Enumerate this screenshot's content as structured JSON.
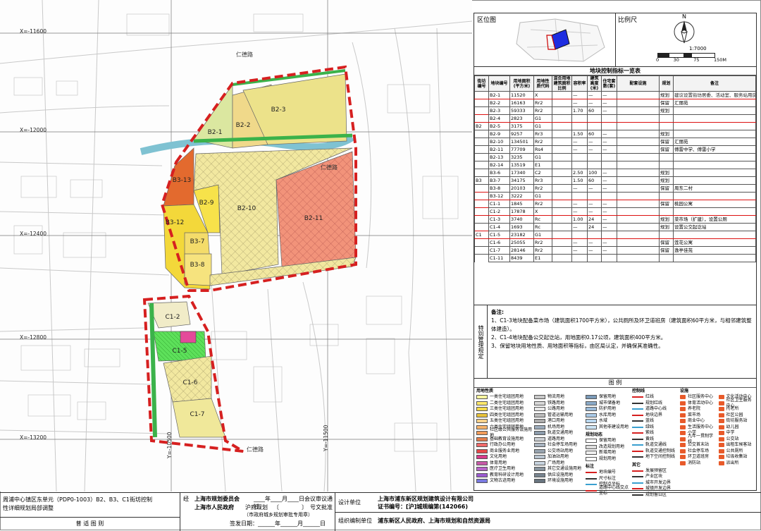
{
  "map": {
    "coords_x": [
      "X=-11600",
      "X=-12000",
      "X=-12400",
      "X=-12800",
      "X=-13200"
    ],
    "coords_y": [
      "Y=-10500",
      "Y=-11500"
    ],
    "roads": [
      "仁德路",
      "仁德路",
      "仁德路"
    ],
    "parcels": [
      "B2-3",
      "B2-2",
      "B2-1",
      "B3-13",
      "B2-9",
      "B2-10",
      "B2-11",
      "B3-12",
      "B3-7",
      "B3-8",
      "C1-2",
      "C1-5",
      "C1-6",
      "C1-7"
    ]
  },
  "panel": {
    "location_title": "区位图",
    "scale_title": "比例尺",
    "scale_ratio": "1:7000",
    "scale_ticks": [
      "0",
      "30",
      "75",
      "150M"
    ],
    "north": "N",
    "table_title": "地块控制指标一览表",
    "headers": [
      "街坊编号",
      "地块编号",
      "用地面积(平方米)",
      "用地性质代码",
      "混合用地建筑面积比例",
      "容积率",
      "建筑高度(米)",
      "住宅套数(套)",
      "配套设施",
      "规划",
      "备注"
    ],
    "rows": [
      {
        "block": "",
        "id": "B2-1",
        "area": "11520",
        "code": "X",
        "far": "—",
        "h": "—",
        "u": "—",
        "plan": "规划",
        "note": "建议设置街坊居委、活动室、服务站用房",
        "red": true
      },
      {
        "block": "",
        "id": "B2-2",
        "area": "16163",
        "code": "Rr2",
        "far": "—",
        "h": "—",
        "u": "—",
        "plan": "保留",
        "note": "汇丽苑",
        "red": false
      },
      {
        "block": "",
        "id": "B2-3",
        "area": "59333",
        "code": "Rr2",
        "far": "1.70",
        "h": "60",
        "u": "—",
        "plan": "规划",
        "note": "",
        "red": false
      },
      {
        "block": "",
        "id": "B2-4",
        "area": "2823",
        "code": "G1",
        "far": "",
        "h": "",
        "u": "",
        "plan": "",
        "note": "",
        "red": true
      },
      {
        "block": "B2",
        "id": "B2-5",
        "area": "3175",
        "code": "G1",
        "far": "",
        "h": "",
        "u": "",
        "plan": "",
        "note": "",
        "red": false
      },
      {
        "block": "",
        "id": "B2-9",
        "area": "9257",
        "code": "Rr3",
        "far": "1.50",
        "h": "60",
        "u": "—",
        "plan": "规划",
        "note": "",
        "red": false
      },
      {
        "block": "",
        "id": "B2-10",
        "area": "134501",
        "code": "Rr2",
        "far": "—",
        "h": "—",
        "u": "—",
        "plan": "保留",
        "note": "汇丽苑",
        "red": false
      },
      {
        "block": "",
        "id": "B2-11",
        "area": "77709",
        "code": "Rs4",
        "far": "—",
        "h": "—",
        "u": "—",
        "plan": "保留",
        "note": "傅雷中学、傅雷小学",
        "red": false
      },
      {
        "block": "",
        "id": "B2-13",
        "area": "3235",
        "code": "G1",
        "far": "",
        "h": "",
        "u": "",
        "plan": "",
        "note": "",
        "red": false
      },
      {
        "block": "",
        "id": "B2-14",
        "area": "13519",
        "code": "E1",
        "far": "",
        "h": "",
        "u": "",
        "plan": "",
        "note": "",
        "red": false
      },
      {
        "block": "",
        "id": "B3-6",
        "area": "17340",
        "code": "C2",
        "far": "2.50",
        "h": "100",
        "u": "—",
        "plan": "规划",
        "note": "",
        "red": false
      },
      {
        "block": "B3",
        "id": "B3-7",
        "area": "34175",
        "code": "Rr3",
        "far": "1.50",
        "h": "60",
        "u": "—",
        "plan": "规划",
        "note": "",
        "red": false
      },
      {
        "block": "",
        "id": "B3-8",
        "area": "20103",
        "code": "Rr2",
        "far": "—",
        "h": "—",
        "u": "—",
        "plan": "保留",
        "note": "周东二村",
        "red": false
      },
      {
        "block": "",
        "id": "B3-12",
        "area": "3222",
        "code": "G1",
        "far": "",
        "h": "",
        "u": "",
        "plan": "",
        "note": "",
        "red": true
      },
      {
        "block": "",
        "id": "C1-1",
        "area": "1845",
        "code": "Rr2",
        "far": "—",
        "h": "—",
        "u": "—",
        "plan": "保留",
        "note": "桃园公寓",
        "red": false
      },
      {
        "block": "",
        "id": "C1-2",
        "area": "17878",
        "code": "X",
        "far": "—",
        "h": "—",
        "u": "—",
        "plan": "",
        "note": "",
        "red": true
      },
      {
        "block": "",
        "id": "C1-3",
        "area": "3740",
        "code": "Rc",
        "far": "1.00",
        "h": "24",
        "u": "—",
        "plan": "规划",
        "note": "菜市场（扩建），设置公厕",
        "red": false
      },
      {
        "block": "",
        "id": "C1-4",
        "area": "1693",
        "code": "Rc",
        "far": "—",
        "h": "24",
        "u": "—",
        "plan": "规划",
        "note": "设置公交起讫站",
        "red": false
      },
      {
        "block": "C1",
        "id": "C1-5",
        "area": "23182",
        "code": "G1",
        "far": "",
        "h": "",
        "u": "",
        "plan": "",
        "note": "",
        "red": true
      },
      {
        "block": "",
        "id": "C1-6",
        "area": "25055",
        "code": "Rr2",
        "far": "—",
        "h": "—",
        "u": "—",
        "plan": "保留",
        "note": "莲花公寓",
        "red": false
      },
      {
        "block": "",
        "id": "C1-7",
        "area": "28146",
        "code": "Rr2",
        "far": "—",
        "h": "—",
        "u": "—",
        "plan": "保留",
        "note": "逸亭佳苑",
        "red": false
      },
      {
        "block": "",
        "id": "C1-11",
        "area": "8439",
        "code": "E1",
        "far": "",
        "h": "",
        "u": "",
        "plan": "",
        "note": "",
        "red": false
      }
    ],
    "special_title": "特别管理规定",
    "notes_title": "备注:",
    "notes": [
      "1、C1-3地块配备菜市场（建筑面积1700平方米），公共厕所及环卫道班房（建筑面积60平方米，与相邻建筑整体建造）。",
      "2、C1-4地块配备公交起讫站，用地面积0.17公顷，建筑面积400平方米。",
      "3、保留地块用地性质、用地面积等指标，由区局认定，并确保其准确性。"
    ],
    "legend_title": "图 例",
    "legend_groups": {
      "landuse": "用地性质",
      "control": "控制线",
      "facility": "设施",
      "plan_status": "规划动态",
      "mark": "标注",
      "other": "其它"
    },
    "legend_landuse": [
      {
        "c": "#fff6a0",
        "t": "一类住宅组团用地"
      },
      {
        "c": "#ffe86a",
        "t": "二类住宅组团用地"
      },
      {
        "c": "#f4d94a",
        "t": "三类住宅组团用地"
      },
      {
        "c": "#e8c23a",
        "t": "四类住宅组团用地"
      },
      {
        "c": "#ffd28a",
        "t": "五类住宅组团用地"
      },
      {
        "c": "#f6b36a",
        "t": "六类住宅组团用地"
      },
      {
        "c": "#f19c5a",
        "t": "社区级公共服务设施用地"
      },
      {
        "c": "#e37d4a",
        "t": "基础教育设施用地"
      },
      {
        "c": "#f06a6a",
        "t": "行政办公用地"
      },
      {
        "c": "#e84848",
        "t": "商业服务业用地"
      },
      {
        "c": "#d83a8a",
        "t": "文化用地"
      },
      {
        "c": "#c85aa8",
        "t": "体育用地"
      },
      {
        "c": "#b864c8",
        "t": "医疗卫生用地"
      },
      {
        "c": "#9a5ad0",
        "t": "教育科研设计用地"
      },
      {
        "c": "#7a7ae0",
        "t": "文物古迹用地"
      },
      {
        "c": "#5a8ee8",
        "t": "外事用地"
      },
      {
        "c": "#6ab0ea",
        "t": "宗教用地"
      },
      {
        "c": "#7ec8d8",
        "t": "其它公共服务用地"
      },
      {
        "c": "#9ad0b0",
        "t": "商务办公用地"
      },
      {
        "c": "#b8b8b8",
        "t": "一类工业用地"
      },
      {
        "c": "#a0a0a0",
        "t": "二类工业用地"
      },
      {
        "c": "#8a7a6a",
        "t": "三类工业用地"
      },
      {
        "c": "#b09070",
        "t": "工业研发用地"
      },
      {
        "c": "#c8a880",
        "t": "普通仓库用地"
      },
      {
        "c": "#a88860",
        "t": "危险品仓库用地"
      },
      {
        "c": "#d8c0a0",
        "t": "堆场用地"
      }
    ],
    "legend_landuse2": [
      {
        "c": "#c8c8c8",
        "t": "物流用地"
      },
      {
        "c": "#d8d8d8",
        "t": "铁路用地"
      },
      {
        "c": "#e8e8e8",
        "t": "公路用地"
      },
      {
        "c": "#bcbcbc",
        "t": "管道运输用地"
      },
      {
        "c": "#acacac",
        "t": "港口用地"
      },
      {
        "c": "#9cacbc",
        "t": "机场用地"
      },
      {
        "c": "#8c9cac",
        "t": "轨道交通用地"
      },
      {
        "c": "#ccd0d4",
        "t": "道路用地"
      },
      {
        "c": "#a8b4c0",
        "t": "社会停车场用地"
      },
      {
        "c": "#98a4b0",
        "t": "公交场站用地"
      },
      {
        "c": "#b8c4d0",
        "t": "加油站用地"
      },
      {
        "c": "#c8d4e0",
        "t": "广场用地"
      },
      {
        "c": "#88949f",
        "t": "其它交通设施用地"
      },
      {
        "c": "#78848f",
        "t": "供应设施用地"
      },
      {
        "c": "#68747f",
        "t": "环境设施用地"
      },
      {
        "c": "#58646f",
        "t": "安全设施用地"
      },
      {
        "c": "#48545f",
        "t": "其它公用设施用地"
      },
      {
        "c": "#3a8a3a",
        "t": "公园绿地"
      },
      {
        "c": "#6aba5a",
        "t": "防护绿地"
      },
      {
        "c": "#9ad08a",
        "t": "广场绿地"
      },
      {
        "c": "#b8e0a8",
        "t": "生态绿地"
      },
      {
        "c": "#d0ecc8",
        "t": "生产防护绿地"
      },
      {
        "c": "#e0f4d8",
        "t": "农林用地"
      },
      {
        "c": "#c0d8f0",
        "t": "水域"
      }
    ],
    "legend_landuse3": [
      {
        "c": "#7a9ab8",
        "t": "保留用地"
      },
      {
        "c": "#8aaac8",
        "t": "城市储备地"
      },
      {
        "c": "#9abad8",
        "t": "防护用地"
      },
      {
        "c": "#aacae8",
        "t": "水库用地"
      },
      {
        "c": "#bad8f0",
        "t": "水域"
      },
      {
        "c": "#cce4f4",
        "t": "其他非建设用地"
      }
    ],
    "legend_plan_status": [
      {
        "c": "#ffffff",
        "t": "保留用地"
      },
      {
        "c": "#dddddd",
        "t": "改造规划用地"
      },
      {
        "c": "#eeeeee",
        "t": "新增用地"
      },
      {
        "c": "#ffffff",
        "t": "规划用地"
      }
    ],
    "legend_control": [
      "红线",
      "规划红线",
      "道路中心线",
      "地块边界",
      "蓝线",
      "绿线",
      "紫线",
      "黄线",
      "轨道交通线",
      "轨道交通控制线",
      "地下空间控制线",
      "保护范围",
      "地块分界线",
      "机动车出入口",
      "电力通道走廊"
    ],
    "legend_facility": [
      "社区服务中心",
      "文化活动中心",
      "体育活动中心",
      "社区卫生服务中心",
      "养老院",
      "托老所",
      "菜市场",
      "社区公园",
      "商业中心",
      "街坊服务站",
      "生活服务中心",
      "幼儿园",
      "小学",
      "中学",
      "九年一贯制学校",
      "公交站",
      "公交首末站",
      "出租车候客站",
      "社会停车场",
      "公共厕所",
      "环卫道班房",
      "垃圾收集站",
      "消防站",
      "派出所"
    ],
    "legend_other": [
      "发展预留区",
      "产业区块",
      "城市开发边界",
      "城镇开发边界",
      "规划留白区"
    ],
    "legend_marks": [
      "地块编号",
      "尺寸标注",
      "控制点坐标",
      "道路中心线交点坐标"
    ]
  },
  "footer": {
    "title_line1": "周浦中心镇区东单元（PDP0-1003）B2、B3、C1街坊控制",
    "title_line2": "性详细规划局部调整",
    "drawing_name": "普 适 图 则",
    "approval_prefix": "经",
    "committee": "上海市规划委员会",
    "meeting": "____年____月____日会议审议通过,",
    "gov": "上海市人民政府",
    "hufu": "沪府规划",
    "doc": "〔　　　　〕　号文批准",
    "doc_note": "（市政府城乡规划审批专用章）",
    "sign_date": "签发日期：______年______月______日",
    "design_label": "设计单位",
    "design_org": "上海市浦东新区规划建筑设计有限公司",
    "cert": "证书编号：[沪]城规编第(142066)",
    "org_label": "组织编制单位",
    "org": "浦东新区人民政府、上海市规划和自然资源局"
  }
}
